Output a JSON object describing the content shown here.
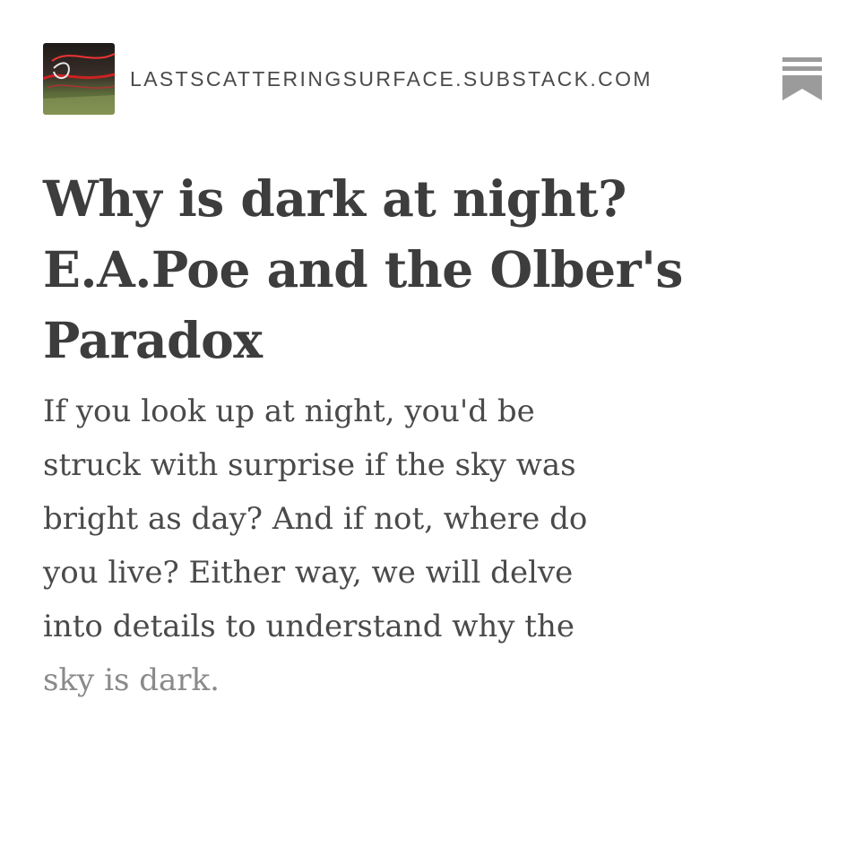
{
  "publication": {
    "domain": "LASTSCATTERINGSURFACE.SUBSTACK.COM",
    "logo_icon": "publication-logo-image"
  },
  "brand_icon": "substack-bookmark-icon",
  "article": {
    "title": "Why is dark at night?\nE.A.Poe and the Olber's\nParadox",
    "subtitle_main": "If you look up at night, you'd be\nstruck with surprise if the sky was\nbright as day? And if not, where do\nyou live? Either way, we will delve\ninto details to understand why the\n",
    "subtitle_faded": "sky is dark."
  },
  "colors": {
    "title": "#3d3d3d",
    "body": "#4a4a4a",
    "faded": "#8a8a8a",
    "icon": "#9b9b9b"
  }
}
